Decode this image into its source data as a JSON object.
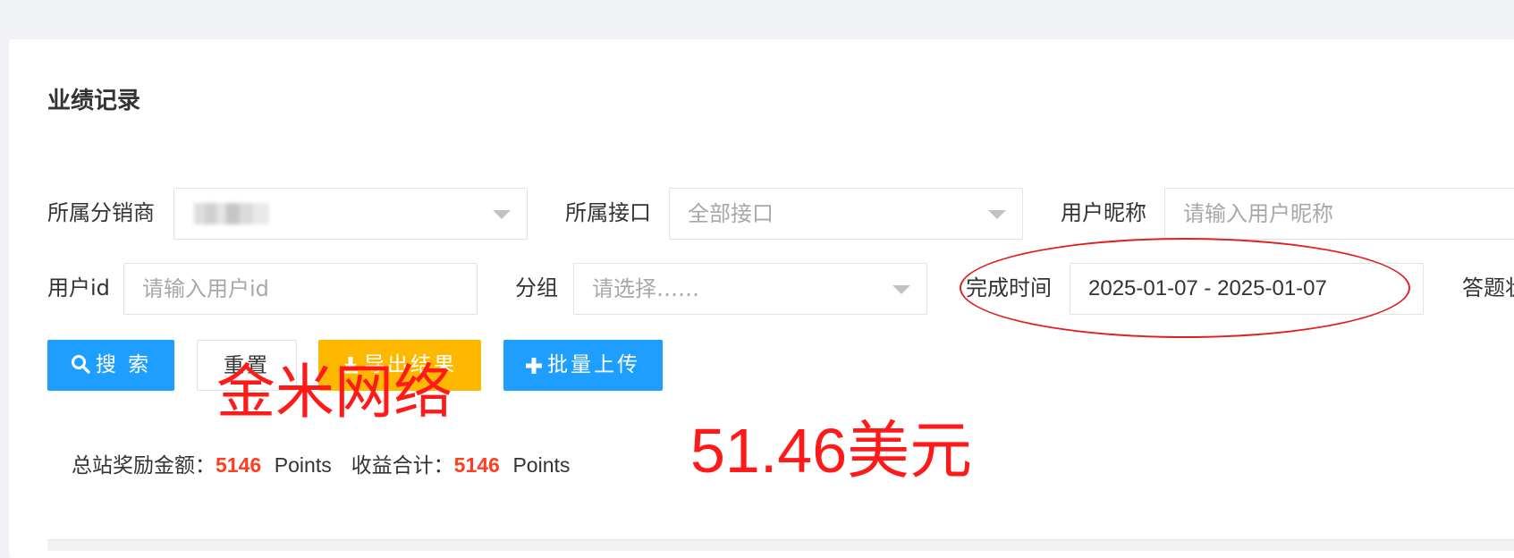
{
  "page": {
    "title": "业绩记录"
  },
  "filters": {
    "distributor": {
      "label": "所属分销商",
      "value": ""
    },
    "interface": {
      "label": "所属接口",
      "value": "全部接口"
    },
    "nickname": {
      "label": "用户昵称",
      "placeholder": "请输入用户昵称"
    },
    "user_id": {
      "label": "用户id",
      "placeholder": "请输入用户id"
    },
    "group": {
      "label": "分组",
      "placeholder": "请选择……"
    },
    "finish_time": {
      "label": "完成时间",
      "value": "2025-01-07 - 2025-01-07"
    },
    "answer_status": {
      "label": "答题状"
    }
  },
  "buttons": {
    "search": "搜 索",
    "reset": "重置",
    "export": "导出结果",
    "batch_upload": "批量上传"
  },
  "summary": {
    "total_reward_label": "总站奖励金额：",
    "total_reward_value": "5146",
    "total_reward_unit": "Points",
    "income_total_label": "收益合计：",
    "income_total_value": "5146",
    "income_total_unit": "Points"
  },
  "annotations": {
    "watermark": "金米网络",
    "amount": "51.46美元"
  },
  "colors": {
    "primary": "#1e9fff",
    "warning": "#ffb800",
    "accent_red": "#ff3d1f",
    "annotation_red": "#ff1a1a"
  },
  "icons": {
    "search": "search-icon",
    "export": "download-icon",
    "batch_upload": "plus-icon",
    "dropdown": "caret-down-icon"
  }
}
